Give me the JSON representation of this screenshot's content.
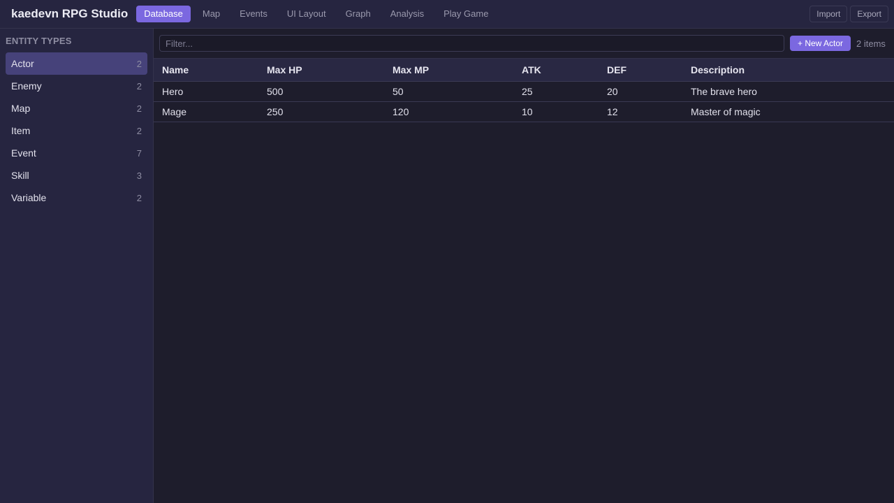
{
  "app": {
    "title": "kaedevn RPG Studio"
  },
  "nav": {
    "tabs": [
      {
        "label": "Database",
        "active": true
      },
      {
        "label": "Map"
      },
      {
        "label": "Events"
      },
      {
        "label": "UI Layout"
      },
      {
        "label": "Graph"
      },
      {
        "label": "Analysis"
      },
      {
        "label": "Play Game"
      }
    ]
  },
  "actions": {
    "import_label": "Import",
    "export_label": "Export"
  },
  "sidebar": {
    "heading": "ENTITY TYPES",
    "items": [
      {
        "label": "Actor",
        "count": "2",
        "active": true
      },
      {
        "label": "Enemy",
        "count": "2"
      },
      {
        "label": "Map",
        "count": "2"
      },
      {
        "label": "Item",
        "count": "2"
      },
      {
        "label": "Event",
        "count": "7"
      },
      {
        "label": "Skill",
        "count": "3"
      },
      {
        "label": "Variable",
        "count": "2"
      }
    ]
  },
  "toolbar": {
    "filter_placeholder": "Filter...",
    "filter_value": "",
    "new_button_label": "+ New Actor",
    "item_count": "2 items"
  },
  "table": {
    "columns": [
      "Name",
      "Max HP",
      "Max MP",
      "ATK",
      "DEF",
      "Description"
    ],
    "rows": [
      [
        "Hero",
        "500",
        "50",
        "25",
        "20",
        "The brave hero"
      ],
      [
        "Mage",
        "250",
        "120",
        "10",
        "12",
        "Master of magic"
      ]
    ]
  },
  "colors": {
    "accent": "#7b68e0",
    "background": "#1e1d2c",
    "panel": "#262540",
    "sidebar_active": "#46427a"
  }
}
